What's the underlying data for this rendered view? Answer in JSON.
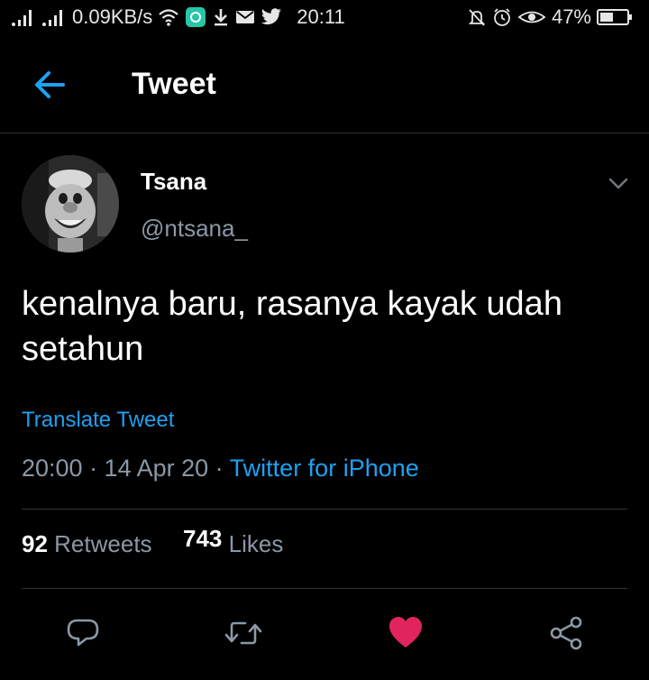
{
  "status_bar": {
    "network_speed": "0.09KB/s",
    "time": "20:11",
    "battery": "47%",
    "left_icons": [
      "signal-icon",
      "signal-icon",
      "wifi-icon",
      "app-icon",
      "download-icon",
      "mail-icon",
      "twitter-icon"
    ],
    "right_icons": [
      "mute-icon",
      "alarm-icon",
      "eye-icon",
      "battery-icon"
    ]
  },
  "header": {
    "title": "Tweet",
    "back_icon": "arrow-left-icon"
  },
  "tweet": {
    "author_name": "Tsana",
    "author_handle": "@ntsana_",
    "text": "kenalnya baru, rasanya kayak udah setahun",
    "translate_label": "Translate Tweet",
    "timestamp": "20:00 · 14 Apr 20 · ",
    "source": "Twitter for iPhone",
    "retweets_count": "92",
    "retweets_label": "Retweets",
    "likes_count": "743",
    "likes_label": "Likes"
  },
  "actions": [
    "reply-icon",
    "retweet-icon",
    "like-icon",
    "share-icon"
  ],
  "colors": {
    "background": "#000000",
    "accent": "#1da1f2",
    "muted": "#8b98a5",
    "like": "#e0245e",
    "divider": "#2f3336"
  }
}
